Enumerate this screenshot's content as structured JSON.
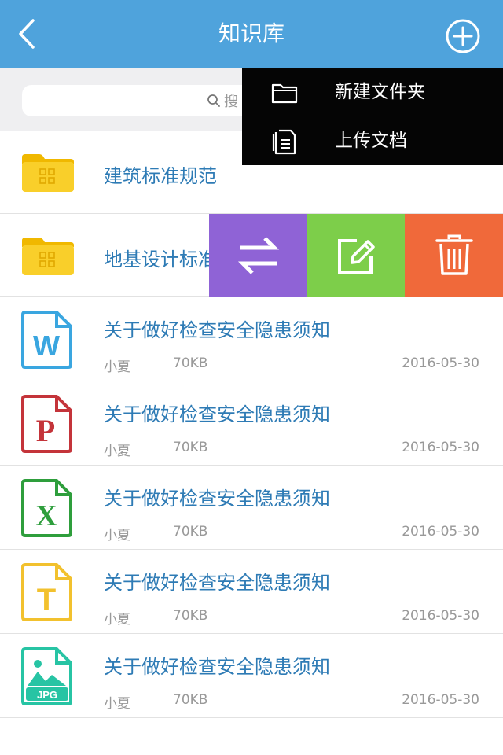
{
  "header": {
    "title": "知识库",
    "background": "#4fa3dc"
  },
  "search": {
    "placeholder": "搜"
  },
  "dropdown": {
    "items": [
      {
        "label": "新建文件夹",
        "icon": "folder-outline-icon"
      },
      {
        "label": "上传文档",
        "icon": "document-outline-icon"
      }
    ]
  },
  "swipe_actions": [
    {
      "name": "move",
      "icon": "swap-arrows-icon",
      "color": "#8f63d6"
    },
    {
      "name": "edit",
      "icon": "edit-icon",
      "color": "#7dce4a"
    },
    {
      "name": "delete",
      "icon": "trash-icon",
      "color": "#f0693a"
    }
  ],
  "folders": [
    {
      "name": "建筑标准规范",
      "icon": "folder-icon"
    },
    {
      "name": "地基设计标准",
      "icon": "folder-icon"
    }
  ],
  "files": [
    {
      "name": "关于做好检查安全隐患须知",
      "author": "小夏",
      "size": "70KB",
      "date": "2016-05-30",
      "type": "word",
      "icon": "word-file-icon",
      "color": "#3aa6e0"
    },
    {
      "name": "关于做好检查安全隐患须知",
      "author": "小夏",
      "size": "70KB",
      "date": "2016-05-30",
      "type": "ppt",
      "icon": "ppt-file-icon",
      "color": "#c4343a"
    },
    {
      "name": "关于做好检查安全隐患须知",
      "author": "小夏",
      "size": "70KB",
      "date": "2016-05-30",
      "type": "excel",
      "icon": "excel-file-icon",
      "color": "#2e9e3c"
    },
    {
      "name": "关于做好检查安全隐患须知",
      "author": "小夏",
      "size": "70KB",
      "date": "2016-05-30",
      "type": "text",
      "icon": "text-file-icon",
      "color": "#f2c12e"
    },
    {
      "name": "关于做好检查安全隐患须知",
      "author": "小夏",
      "size": "70KB",
      "date": "2016-05-30",
      "type": "image",
      "icon": "jpg-file-icon",
      "color": "#27c4a4",
      "badge": "JPG"
    }
  ]
}
